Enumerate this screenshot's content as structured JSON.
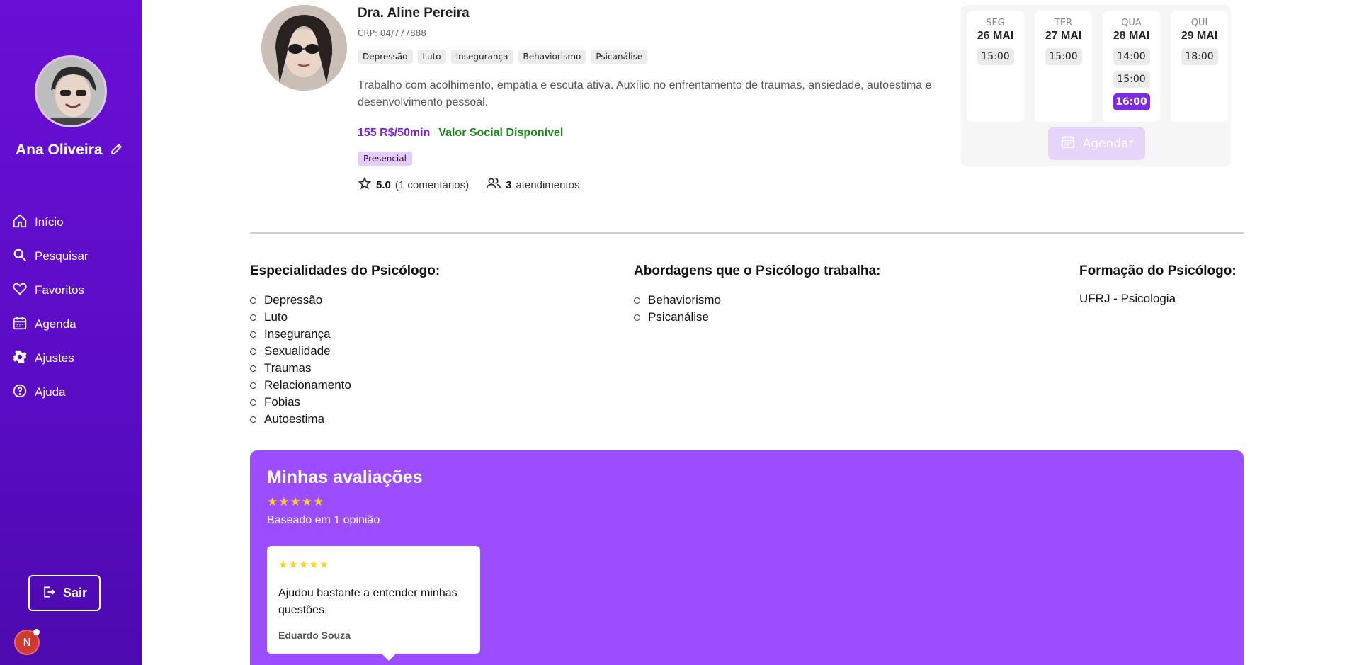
{
  "sidebar": {
    "user_name": "Ana Oliveira",
    "nav": [
      {
        "label": "Início",
        "icon": "home-icon"
      },
      {
        "label": "Pesquisar",
        "icon": "search-icon"
      },
      {
        "label": "Favoritos",
        "icon": "heart-icon"
      },
      {
        "label": "Agenda",
        "icon": "calendar-icon"
      },
      {
        "label": "Ajustes",
        "icon": "gear-icon"
      },
      {
        "label": "Ajuda",
        "icon": "help-icon"
      }
    ],
    "logout_label": "Sair",
    "badge_letter": "N"
  },
  "psychologist": {
    "name": "Dra. Aline Pereira",
    "crp": "CRP: 04/777888",
    "tags": [
      "Depressão",
      "Luto",
      "Insegurança",
      "Behaviorismo",
      "Psicanálise"
    ],
    "description": "Trabalho com acolhimento, empatia e escuta ativa. Auxílio no enfrentamento de traumas, ansiedade, autoestima e desenvolvimento pessoal.",
    "price": "155 R$/50min",
    "social": "Valor Social Disponível",
    "mode": "Presencial",
    "rating": "5.0",
    "comments": "(1 comentários)",
    "appointments_count": "3",
    "appointments_label": "atendimentos"
  },
  "schedule": {
    "days": [
      {
        "name": "SEG",
        "date": "26 MAI",
        "slots": [
          "15:00"
        ]
      },
      {
        "name": "TER",
        "date": "27 MAI",
        "slots": [
          "15:00"
        ]
      },
      {
        "name": "QUA",
        "date": "28 MAI",
        "slots": [
          "14:00",
          "15:00",
          "16:00"
        ],
        "selected": "16:00"
      },
      {
        "name": "QUI",
        "date": "29 MAI",
        "slots": [
          "18:00"
        ]
      }
    ],
    "button_label": "Agendar"
  },
  "specialties": {
    "title": "Especialidades do Psicólogo:",
    "items": [
      "Depressão",
      "Luto",
      "Insegurança",
      "Sexualidade",
      "Traumas",
      "Relacionamento",
      "Fobias",
      "Autoestima"
    ]
  },
  "approaches": {
    "title": "Abordagens que o Psicólogo trabalha:",
    "items": [
      "Behaviorismo",
      "Psicanálise"
    ]
  },
  "education": {
    "title": "Formação do Psicólogo:",
    "value": "UFRJ - Psicologia"
  },
  "reviews": {
    "title": "Minhas avaliações",
    "stars": "★★★★★",
    "based_on": "Baseado em 1 opinião",
    "items": [
      {
        "stars": "★★★★★",
        "text": "Ajudou bastante a entender minhas questões.",
        "author": "Eduardo Souza"
      }
    ]
  },
  "colors": {
    "sidebar": "#5a0cc4",
    "accent": "#7c2be0",
    "reviews_bg": "#9b4dff",
    "social_green": "#1a8a1a",
    "star": "#ffd21f"
  }
}
